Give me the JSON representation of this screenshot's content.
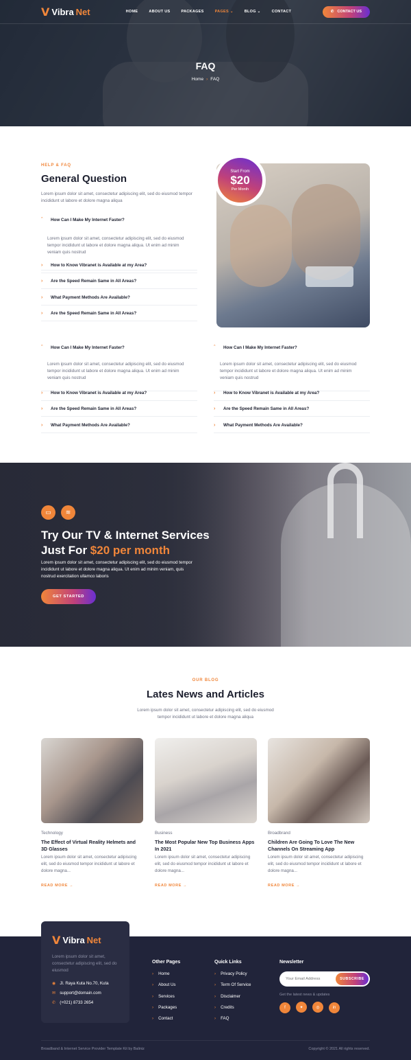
{
  "brand": {
    "name_1": "Vibra",
    "name_2": "Net",
    "accent": "#f0863a",
    "purple": "#6a2fd1"
  },
  "nav": {
    "items": [
      "HOME",
      "ABOUT US",
      "PACKAGES",
      "PAGES",
      "BLOG",
      "CONTACT"
    ],
    "active": "PAGES",
    "contact_button": "CONTACT US"
  },
  "hero": {
    "title": "FAQ",
    "crumb_home": "Home",
    "crumb_current": "FAQ"
  },
  "faq": {
    "kicker": "HELP & FAQ",
    "title": "General Question",
    "intro": "Lorem ipsum dolor sit amet, consectetur adipiscing elit, sed do eiusmod tempor incididunt ut labore et dolore magna aliqua",
    "answer": "Lorem ipsum dolor sit amet, consectetur adipiscing elit, sed do eiusmod tempor incididunt ut labore et dolore magna aliqua. Ut enim ad minim veniam quis nostrud",
    "list_main": [
      "How Can I Make My Internet Faster?",
      "How to Know Vibranet is Available at my Area?",
      "Are the Speed Remain Same in All Areas?",
      "What Payment Methods Are Available?",
      "Are the Speed Remain Same in All Areas?"
    ],
    "list_left": [
      "How Can I Make My Internet Faster?",
      "How to Know Vibranet is Available at my Area?",
      "Are the Speed Remain Same in All Areas?",
      "What Payment Methods Are Available?"
    ],
    "list_right": [
      "How Can I Make My Internet Faster?",
      "How to Know Vibranet is Available at my Area?",
      "Are the Speed Remain Same in All Areas?",
      "What Payment Methods Are Available?"
    ],
    "price_label": "Start From",
    "price_value": "$20",
    "price_unit": "Per Month"
  },
  "cta": {
    "title_line1": "Try Our TV & Internet Services",
    "title_prefix": "Just For ",
    "title_highlight": "$20 per month",
    "text": "Lorem ipsum dolor sit amet, consectetur adipiscing elit, sed do eiusmod tempor incididunt ut labore et dolore magna aliqua. Ut enim ad minim veniam, quis nostrud exercitation ullamco laboris",
    "button": "GET STARTED"
  },
  "blog": {
    "kicker": "OUR BLOG",
    "title": "Lates News and Articles",
    "intro": "Lorem ipsum dolor sit amet, consectetur adipiscing elit, sed do eiusmod tempor incididunt ut labore et dolore magna aliqua",
    "posts": [
      {
        "category": "Technology",
        "title": "The Effect of Virtual Reality Helmets and 3D Glasses",
        "excerpt": "Lorem ipsum dolor sit amet, consectetur adipiscing elit, sed do eiusmod tempor incididunt ut labore et dolore magna...",
        "link": "READ MORE"
      },
      {
        "category": "Business",
        "title": "The Most Popular New Top Business Apps In 2021",
        "excerpt": "Lorem ipsum dolor sit amet, consectetur adipiscing elit, sed do eiusmod tempor incididunt ut labore et dolore magna...",
        "link": "READ MORE"
      },
      {
        "category": "Broadbrand",
        "title": "Children Are Going To Love The New Channels On Streaming App",
        "excerpt": "Lorem ipsum dolor sit amet, consectetur adipiscing elit, sed do eiusmod tempor incididunt ut labore et dolore magna...",
        "link": "READ MORE"
      }
    ]
  },
  "footer": {
    "about": "Lorem ipsum dolor sit amet, consectetur adipiscing elit, sed do eiusmod",
    "address": "Jl. Raya Kuta No.70, Kuta",
    "email": "support@domain.com",
    "phone": "(+021) 8733 2654",
    "other_pages_title": "Other Pages",
    "other_pages": [
      "Home",
      "About Us",
      "Services",
      "Packages",
      "Contact"
    ],
    "quick_links_title": "Quick Links",
    "quick_links": [
      "Privacy Policy",
      "Term Of Service",
      "Disclaimer",
      "Credits",
      "FAQ"
    ],
    "newsletter_title": "Newsletter",
    "email_placeholder": "Your Email Address",
    "subscribe": "SUBSCRIBE",
    "newsletter_note": "Get the latest news & updates",
    "social": [
      "f",
      "t",
      "◎",
      "in"
    ],
    "copyright_left": "Broadband & Internet Service Provider Template Kit by Baliniz",
    "copyright_right": "Copyright © 2021 All rights reserved."
  }
}
